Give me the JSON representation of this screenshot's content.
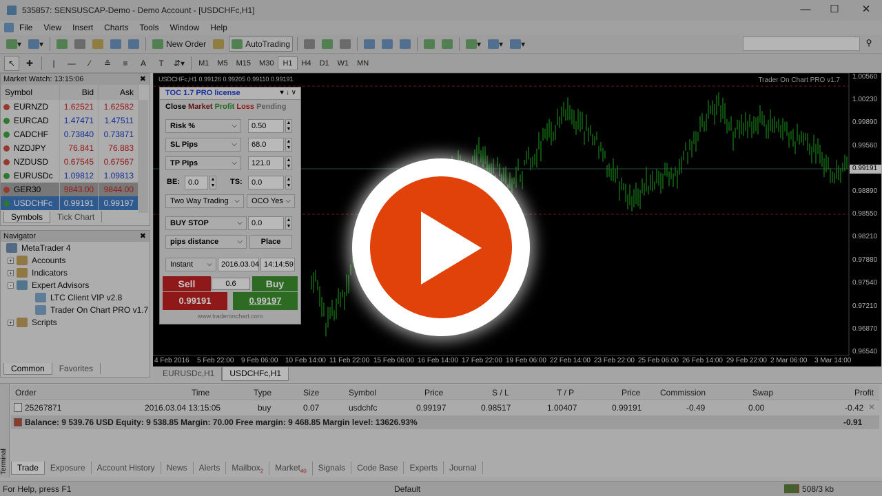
{
  "window": {
    "title": "535857: SENSUSCAP-Demo - Demo Account - [USDCHFc,H1]"
  },
  "menu": [
    "File",
    "View",
    "Insert",
    "Charts",
    "Tools",
    "Window",
    "Help"
  ],
  "toolbar": {
    "new_order": "New Order",
    "autotrading": "AutoTrading"
  },
  "timeframes": [
    "M1",
    "M5",
    "M15",
    "M30",
    "H1",
    "H4",
    "D1",
    "W1",
    "MN"
  ],
  "active_timeframe": "H1",
  "market_watch": {
    "title": "Market Watch: 13:15:06",
    "columns": [
      "Symbol",
      "Bid",
      "Ask"
    ],
    "rows": [
      {
        "symbol": "EURNZD",
        "bid": "1.62521",
        "ask": "1.62582",
        "color": "red"
      },
      {
        "symbol": "EURCAD",
        "bid": "1.47471",
        "ask": "1.47511",
        "color": "blue"
      },
      {
        "symbol": "CADCHF",
        "bid": "0.73840",
        "ask": "0.73871",
        "color": "blue"
      },
      {
        "symbol": "NZDJPY",
        "bid": "76.841",
        "ask": "76.883",
        "color": "red"
      },
      {
        "symbol": "NZDUSD",
        "bid": "0.67545",
        "ask": "0.67567",
        "color": "red"
      },
      {
        "symbol": "EURUSDc",
        "bid": "1.09812",
        "ask": "1.09813",
        "color": "blue"
      },
      {
        "symbol": "GER30",
        "bid": "9843.00",
        "ask": "9844.00",
        "color": "red"
      },
      {
        "symbol": "USDCHFc",
        "bid": "0.99191",
        "ask": "0.99197",
        "color": "blue"
      }
    ],
    "tabs": [
      "Symbols",
      "Tick Chart"
    ]
  },
  "navigator": {
    "title": "Navigator",
    "items": [
      "MetaTrader 4",
      "Accounts",
      "Indicators",
      "Expert Advisors",
      "LTC Client VIP v2.8",
      "Trader On Chart PRO v1.7",
      "Scripts"
    ],
    "tabs": [
      "Common",
      "Favorites"
    ]
  },
  "chart": {
    "info": "USDCHFc,H1  0.99126 0.99205 0.99110 0.99191",
    "brand": "Trader On Chart PRO v1.7",
    "price_labels": [
      "1.00560",
      "1.00230",
      "0.99890",
      "0.99560",
      "0.99191",
      "0.98890",
      "0.98550",
      "0.98210",
      "0.97880",
      "0.97540",
      "0.97210",
      "0.96870",
      "0.96540"
    ],
    "current_price": "0.99191",
    "time_labels": [
      "4 Feb 2016",
      "5 Feb 22:00",
      "9 Feb 06:00",
      "10 Feb 14:00",
      "11 Feb 22:00",
      "15 Feb 06:00",
      "16 Feb 14:00",
      "17 Feb 22:00",
      "19 Feb 06:00",
      "22 Feb 14:00",
      "23 Feb 22:00",
      "25 Feb 06:00",
      "26 Feb 14:00",
      "29 Feb 22:00",
      "2 Mar 06:00",
      "3 Mar 14:00"
    ],
    "tabs": [
      "EURUSDc,H1",
      "USDCHFc,H1"
    ]
  },
  "toc": {
    "title": "TOC 1.7 PRO license",
    "controls": "♥ ↓ ∨",
    "mode_tabs": [
      "Close",
      "Market",
      "Profit",
      "Loss",
      "Pending"
    ],
    "risk_label": "Risk %",
    "risk_value": "0.50",
    "sl_label": "SL Pips",
    "sl_value": "68.0",
    "tp_label": "TP Pips",
    "tp_value": "121.0",
    "be_label": "BE:",
    "be_value": "0.0",
    "ts_label": "TS:",
    "ts_value": "0.0",
    "trading_mode": "Two Way Trading",
    "oco": "OCO Yes",
    "pending_type": "BUY STOP",
    "pending_value": "0.0",
    "distance_mode": "pips distance",
    "place": "Place",
    "exec": "Instant",
    "date": "2016.03.04",
    "time": "14:14:59",
    "sell": "Sell",
    "buy": "Buy",
    "lot": "0.6",
    "sell_price": "0.99191",
    "buy_price": "0.99197",
    "url": "www.traderonchart.com"
  },
  "terminal": {
    "columns": [
      "Order",
      "Time",
      "Type",
      "Size",
      "Symbol",
      "Price",
      "S / L",
      "T / P",
      "Price",
      "Commission",
      "Swap",
      "Profit"
    ],
    "order": {
      "order": "25267871",
      "time": "2016.03.04 13:15:05",
      "type": "buy",
      "size": "0.07",
      "symbol": "usdchfc",
      "price": "0.99197",
      "sl": "0.98517",
      "tp": "1.00407",
      "price2": "0.99191",
      "commission": "-0.49",
      "swap": "0.00",
      "profit": "-0.42"
    },
    "balance": "Balance: 9 539.76 USD  Equity: 9 538.85  Margin: 70.00  Free margin: 9 468.85  Margin level: 13626.93%",
    "total": "-0.91",
    "tabs": [
      {
        "label": "Trade",
        "badge": ""
      },
      {
        "label": "Exposure",
        "badge": ""
      },
      {
        "label": "Account History",
        "badge": ""
      },
      {
        "label": "News",
        "badge": ""
      },
      {
        "label": "Alerts",
        "badge": ""
      },
      {
        "label": "Mailbox",
        "badge": "2"
      },
      {
        "label": "Market",
        "badge": "40"
      },
      {
        "label": "Signals",
        "badge": ""
      },
      {
        "label": "Code Base",
        "badge": ""
      },
      {
        "label": "Experts",
        "badge": ""
      },
      {
        "label": "Journal",
        "badge": ""
      }
    ],
    "side_label": "Terminal"
  },
  "status": {
    "help": "For Help, press F1",
    "profile": "Default",
    "traffic": "508/3 kb"
  },
  "overlay": {
    "icon": "play-button-icon",
    "color": "#e0420a"
  }
}
